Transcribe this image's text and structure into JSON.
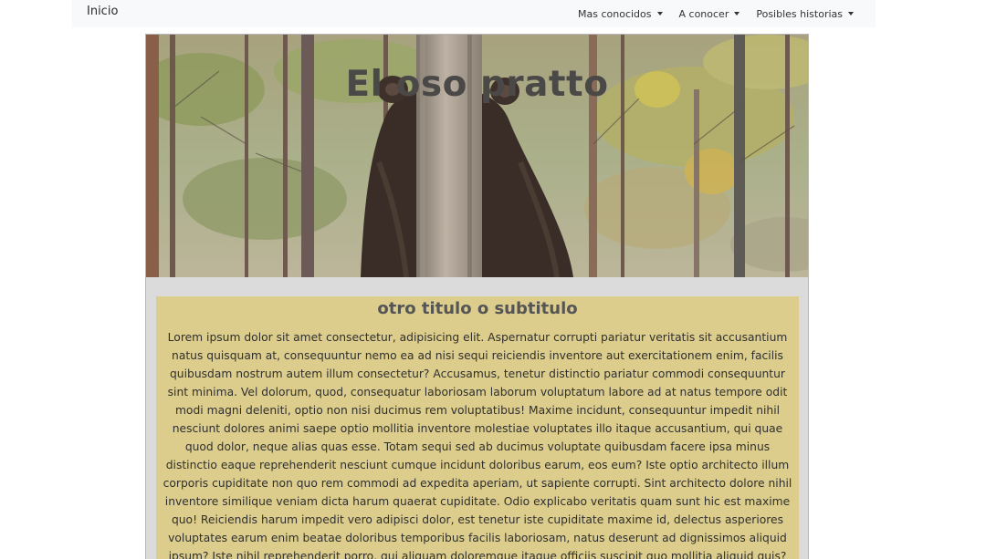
{
  "navbar": {
    "brand": "Inicio",
    "menu": [
      {
        "label": "Mas conocidos"
      },
      {
        "label": "A conocer"
      },
      {
        "label": "Posibles historias"
      }
    ]
  },
  "hero": {
    "title": "El oso pratto"
  },
  "article": {
    "subtitle": "otro titulo o subtitulo",
    "body": "Lorem ipsum dolor sit amet consectetur, adipisicing elit. Aspernatur corrupti pariatur veritatis sit accusantium natus quisquam at, consequuntur nemo ea ad nisi sequi reiciendis inventore aut exercitationem enim, facilis quibusdam nostrum autem illum consectetur? Accusamus, tenetur distinctio pariatur commodi consequuntur sint minima. Vel dolorum, quod, consequatur laboriosam laborum voluptatum labore ad at natus tempore odit modi magni deleniti, optio non nisi ducimus rem voluptatibus! Maxime incidunt, consequuntur impedit nihil nesciunt dolores animi saepe optio mollitia inventore molestiae voluptates illo itaque accusantium, qui quae quod dolor, neque alias quas esse. Totam sequi sed ab ducimus voluptate quibusdam facere ipsa minus distinctio eaque reprehenderit nesciunt cumque incidunt doloribus earum, eos eum? Iste optio architecto illum corporis cupiditate non quo rem commodi ad expedita aperiam, ut sapiente corrupti. Sint architecto dolore nihil inventore similique veniam dicta harum quaerat cupiditate. Odio explicabo veritatis quam sunt hic est maxime quo! Reiciendis harum impedit vero adipisci dolor, est tenetur iste cupiditate maxime id, delectus asperiores voluptates earum enim beatae doloribus temporibus facilis laboriosam, natus deserunt ad dignissimos aliquid ipsum? Iste nihil reprehenderit porro, qui aliquam doloremque itaque officiis suscipit quo mollitia aliquid quis? Cum est, nam"
  },
  "colors": {
    "navbar_bg": "#f8f9fa",
    "page_bg": "#dcdbdb",
    "article_bg": "#dccd8d",
    "title_text": "#4b4947"
  }
}
